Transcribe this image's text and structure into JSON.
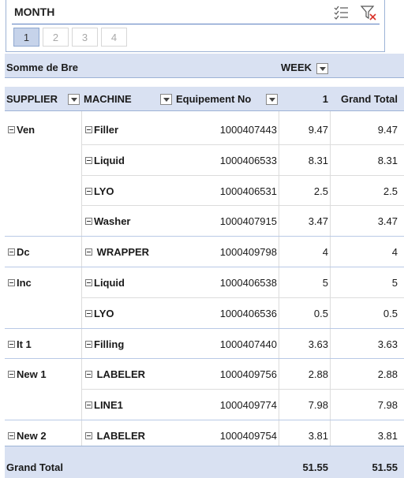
{
  "slicer": {
    "title": "MONTH",
    "buttons": [
      "1",
      "2",
      "3",
      "4"
    ],
    "selected_index": 0,
    "icons": [
      "multi-select-icon",
      "clear-filter-icon"
    ]
  },
  "pivot": {
    "value_field": "Somme de Bre",
    "column_field": "WEEK",
    "headers": {
      "supplier": "SUPPLIER",
      "machine": "MACHINE",
      "equipment": "Equipement No",
      "week_value": "1",
      "grand_total": "Grand Total"
    },
    "rows": [
      {
        "supplier": "Ven",
        "machine": "Filler",
        "equipment": "1000407443",
        "week": "9.47",
        "total": "9.47"
      },
      {
        "supplier": "",
        "machine": "Liquid",
        "equipment": "1000406533",
        "week": "8.31",
        "total": "8.31"
      },
      {
        "supplier": "",
        "machine": "LYO",
        "equipment": "1000406531",
        "week": "2.5",
        "total": "2.5"
      },
      {
        "supplier": "",
        "machine": "Washer",
        "equipment": "1000407915",
        "week": "3.47",
        "total": "3.47"
      },
      {
        "supplier": "Dc",
        "machine": " WRAPPER",
        "equipment": "1000409798",
        "week": "4",
        "total": "4"
      },
      {
        "supplier": "Inc",
        "machine": "Liquid",
        "equipment": "1000406538",
        "week": "5",
        "total": "5"
      },
      {
        "supplier": "",
        "machine": "LYO",
        "equipment": "1000406536",
        "week": "0.5",
        "total": "0.5"
      },
      {
        "supplier": "It 1",
        "machine": "Filling",
        "equipment": "1000407440",
        "week": "3.63",
        "total": "3.63"
      },
      {
        "supplier": "New 1",
        "machine": " LABELER",
        "equipment": "1000409756",
        "week": "2.88",
        "total": "2.88"
      },
      {
        "supplier": "",
        "machine": "LINE1",
        "equipment": "1000409774",
        "week": "7.98",
        "total": "7.98"
      },
      {
        "supplier": "New 2",
        "machine": " LABELER",
        "equipment": "1000409754",
        "week": "3.81",
        "total": "3.81"
      }
    ],
    "grand_total": {
      "label": "Grand Total",
      "week": "51.55",
      "total": "51.55"
    }
  }
}
